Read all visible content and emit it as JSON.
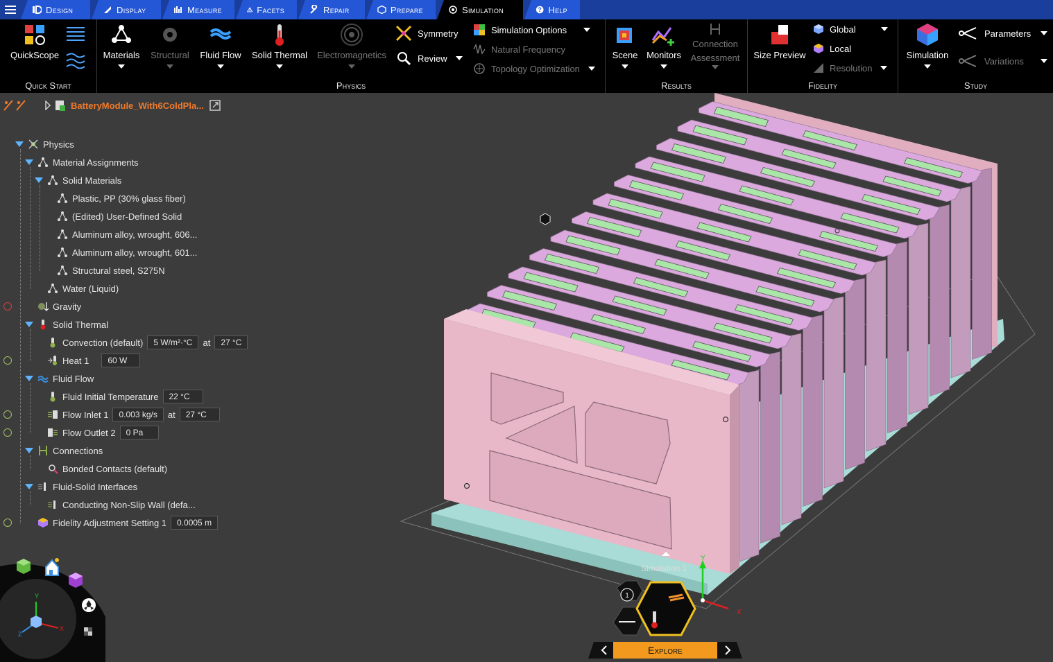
{
  "tabs": [
    {
      "label": "Design",
      "active": false
    },
    {
      "label": "Display",
      "active": false
    },
    {
      "label": "Measure",
      "active": false
    },
    {
      "label": "Facets",
      "active": false
    },
    {
      "label": "Repair",
      "active": false
    },
    {
      "label": "Prepare",
      "active": false
    },
    {
      "label": "Simulation",
      "active": true
    },
    {
      "label": "Help",
      "active": false
    }
  ],
  "ribbon": {
    "quick_start": {
      "label": "Quick Start",
      "quickscope": "QuickScope"
    },
    "physics": {
      "label": "Physics",
      "materials": "Materials",
      "structural": "Structural",
      "fluid_flow": "Fluid Flow",
      "solid_thermal": "Solid Thermal",
      "electromagnetics": "Electromagnetics",
      "symmetry": "Symmetry",
      "review": "Review",
      "simulation_options": "Simulation Options",
      "natural_frequency": "Natural Frequency",
      "topology_optimization": "Topology Optimization"
    },
    "results": {
      "label": "Results",
      "scene": "Scene",
      "monitors": "Monitors",
      "connection_assessment_1": "Connection",
      "connection_assessment_2": "Assessment"
    },
    "fidelity": {
      "label": "Fidelity",
      "size_preview": "Size Preview",
      "global": "Global",
      "local": "Local",
      "resolution": "Resolution"
    },
    "study": {
      "label": "Study",
      "simulation": "Simulation",
      "parameters": "Parameters",
      "variations": "Variations"
    }
  },
  "breadcrumb": {
    "file": "BatteryModule_With6ColdPla..."
  },
  "tree": {
    "physics": "Physics",
    "material_assignments": "Material Assignments",
    "solid_materials": "Solid Materials",
    "mat1": "Plastic, PP (30% glass fiber)",
    "mat2": "(Edited) User-Defined Solid",
    "mat3": "Aluminum alloy, wrought, 606...",
    "mat4": "Aluminum alloy, wrought, 601...",
    "mat5": "Structural steel, S275N",
    "water": "Water (Liquid)",
    "gravity": "Gravity",
    "solid_thermal": "Solid Thermal",
    "convection": "Convection (default)",
    "convection_value": "5 W/m²·°C",
    "at": "at",
    "convection_temp": "27 °C",
    "heat1": "Heat 1",
    "heat1_value": "60 W",
    "fluid_flow": "Fluid Flow",
    "fluid_init": "Fluid Initial Temperature",
    "fluid_init_value": "22 °C",
    "inlet": "Flow Inlet 1",
    "inlet_value": "0.003 kg/s",
    "inlet_temp": "27 °C",
    "outlet": "Flow Outlet 2",
    "outlet_value": "0 Pa",
    "connections": "Connections",
    "bonded": "Bonded Contacts (default)",
    "fsi": "Fluid-Solid Interfaces",
    "conducting": "Conducting Non-Slip Wall (defa...",
    "fidelity_adj": "Fidelity Adjustment Setting 1",
    "fidelity_value": "0.0005 m"
  },
  "viewport": {
    "sim_label": "Simulation 1",
    "badge": "1",
    "explore": "Explore",
    "axis_x": "X",
    "axis_y": "Y",
    "axis_z": "Z"
  },
  "colors": {
    "tabbar": "#1a3e9c",
    "tab": "#2457d6",
    "accent": "#5fb4ff",
    "explore": "#f39a1e",
    "module": "#e8b7c8",
    "cells": "#d9aedb",
    "slots": "#a9e6a8",
    "plate": "#a9dcd6"
  }
}
